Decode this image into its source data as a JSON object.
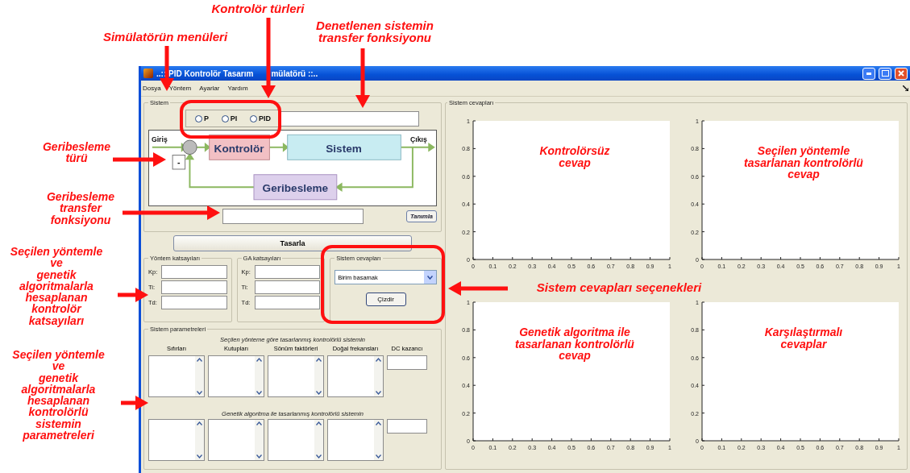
{
  "window": {
    "title_fragments": [
      "..:: PID Kontrolör Tasarım",
      "mülatörü ::.."
    ]
  },
  "menus": [
    "Dosya",
    "Yöntem",
    "Ayarlar",
    "Yardım"
  ],
  "system": {
    "legend": "Sistem",
    "controller_types": [
      {
        "label": "P",
        "selected": false
      },
      {
        "label": "PI",
        "selected": false
      },
      {
        "label": "PID",
        "selected": false
      }
    ],
    "diagram": {
      "input": "Giriş",
      "controller": "Kontrolör",
      "plant": "Sistem",
      "feedback": "Geribesleme",
      "output": "Çıkış",
      "feedback_sign": "-"
    },
    "define_button": "Tanımla"
  },
  "design_button": "Tasarla",
  "method_coefficients": {
    "legend": "Yöntem katsayıları",
    "fields": [
      "Kp:",
      "Ti:",
      "Td:"
    ]
  },
  "ga_coefficients": {
    "legend": "GA katsayıları",
    "fields": [
      "Kp:",
      "Ti:",
      "Td:"
    ]
  },
  "response_select": {
    "legend": "Sistem cevapları",
    "value": "Birim basamak",
    "plot_button": "Çizdir"
  },
  "parameters": {
    "legend": "Sistem parametreleri",
    "columns": [
      "Sıfırları",
      "Kutupları",
      "Sönüm faktörleri",
      "Doğal frekansları",
      "DC kazancı"
    ],
    "sections": [
      {
        "heading": "Seçilen yönteme göre tasarlanmış kontrolörlü sistemin"
      },
      {
        "heading": "Genetik algoritma ile tasarlanmış kontrolörlü sistemin"
      }
    ]
  },
  "responses": {
    "legend": "Sistem cevapları",
    "charts": [
      {
        "annotation": "Kontrolörsüz\ncevap",
        "chart_data": {
          "type": "line",
          "xlim": [
            0,
            1
          ],
          "ylim": [
            0,
            1
          ],
          "xticks": [
            0,
            0.1,
            0.2,
            0.3,
            0.4,
            0.5,
            0.6,
            0.7,
            0.8,
            0.9,
            1
          ],
          "yticks": [
            0,
            0.2,
            0.4,
            0.6,
            0.8,
            1
          ]
        }
      },
      {
        "annotation": "Seçilen yöntemle\ntasarlanan kontrolörlü\ncevap",
        "chart_data": {
          "type": "line",
          "xlim": [
            0,
            1
          ],
          "ylim": [
            0,
            1
          ],
          "xticks": [
            0,
            0.1,
            0.2,
            0.3,
            0.4,
            0.5,
            0.6,
            0.7,
            0.8,
            0.9,
            1
          ],
          "yticks": [
            0,
            0.2,
            0.4,
            0.6,
            0.8,
            1
          ]
        }
      },
      {
        "annotation": "Genetik algoritma ile\ntasarlanan kontrolörlü\ncevap",
        "chart_data": {
          "type": "line",
          "xlim": [
            0,
            1
          ],
          "ylim": [
            0,
            1
          ],
          "xticks": [
            0,
            0.1,
            0.2,
            0.3,
            0.4,
            0.5,
            0.6,
            0.7,
            0.8,
            0.9,
            1
          ],
          "yticks": [
            0,
            0.2,
            0.4,
            0.6,
            0.8,
            1
          ]
        }
      },
      {
        "annotation": "Karşılaştırmalı\ncevaplar",
        "chart_data": {
          "type": "line",
          "xlim": [
            0,
            1
          ],
          "ylim": [
            0,
            1
          ],
          "xticks": [
            0,
            0.1,
            0.2,
            0.3,
            0.4,
            0.5,
            0.6,
            0.7,
            0.8,
            0.9,
            1
          ],
          "yticks": [
            0,
            0.2,
            0.4,
            0.6,
            0.8,
            1
          ]
        }
      }
    ]
  },
  "annotations": [
    {
      "text": "Simülatörün menüleri"
    },
    {
      "text": "Kontrolör türleri"
    },
    {
      "text": "Denetlenen sistemin\ntransfer fonksiyonu"
    },
    {
      "text": "Geribesleme\ntürü"
    },
    {
      "text": "Geribesleme\ntransfer\nfonksiyonu"
    },
    {
      "text": "Seçilen yöntemle\nve\ngenetik\nalgoritmalarla\nhesaplanan\nkontrolör\nkatsayıları"
    },
    {
      "text": "Seçilen yöntemle\nve\ngenetik\nalgoritmalarla\nhesaplanan\nkontrolörlü\nsistemin\nparametreleri"
    },
    {
      "text": "Sistem cevapları seçenekleri"
    }
  ]
}
